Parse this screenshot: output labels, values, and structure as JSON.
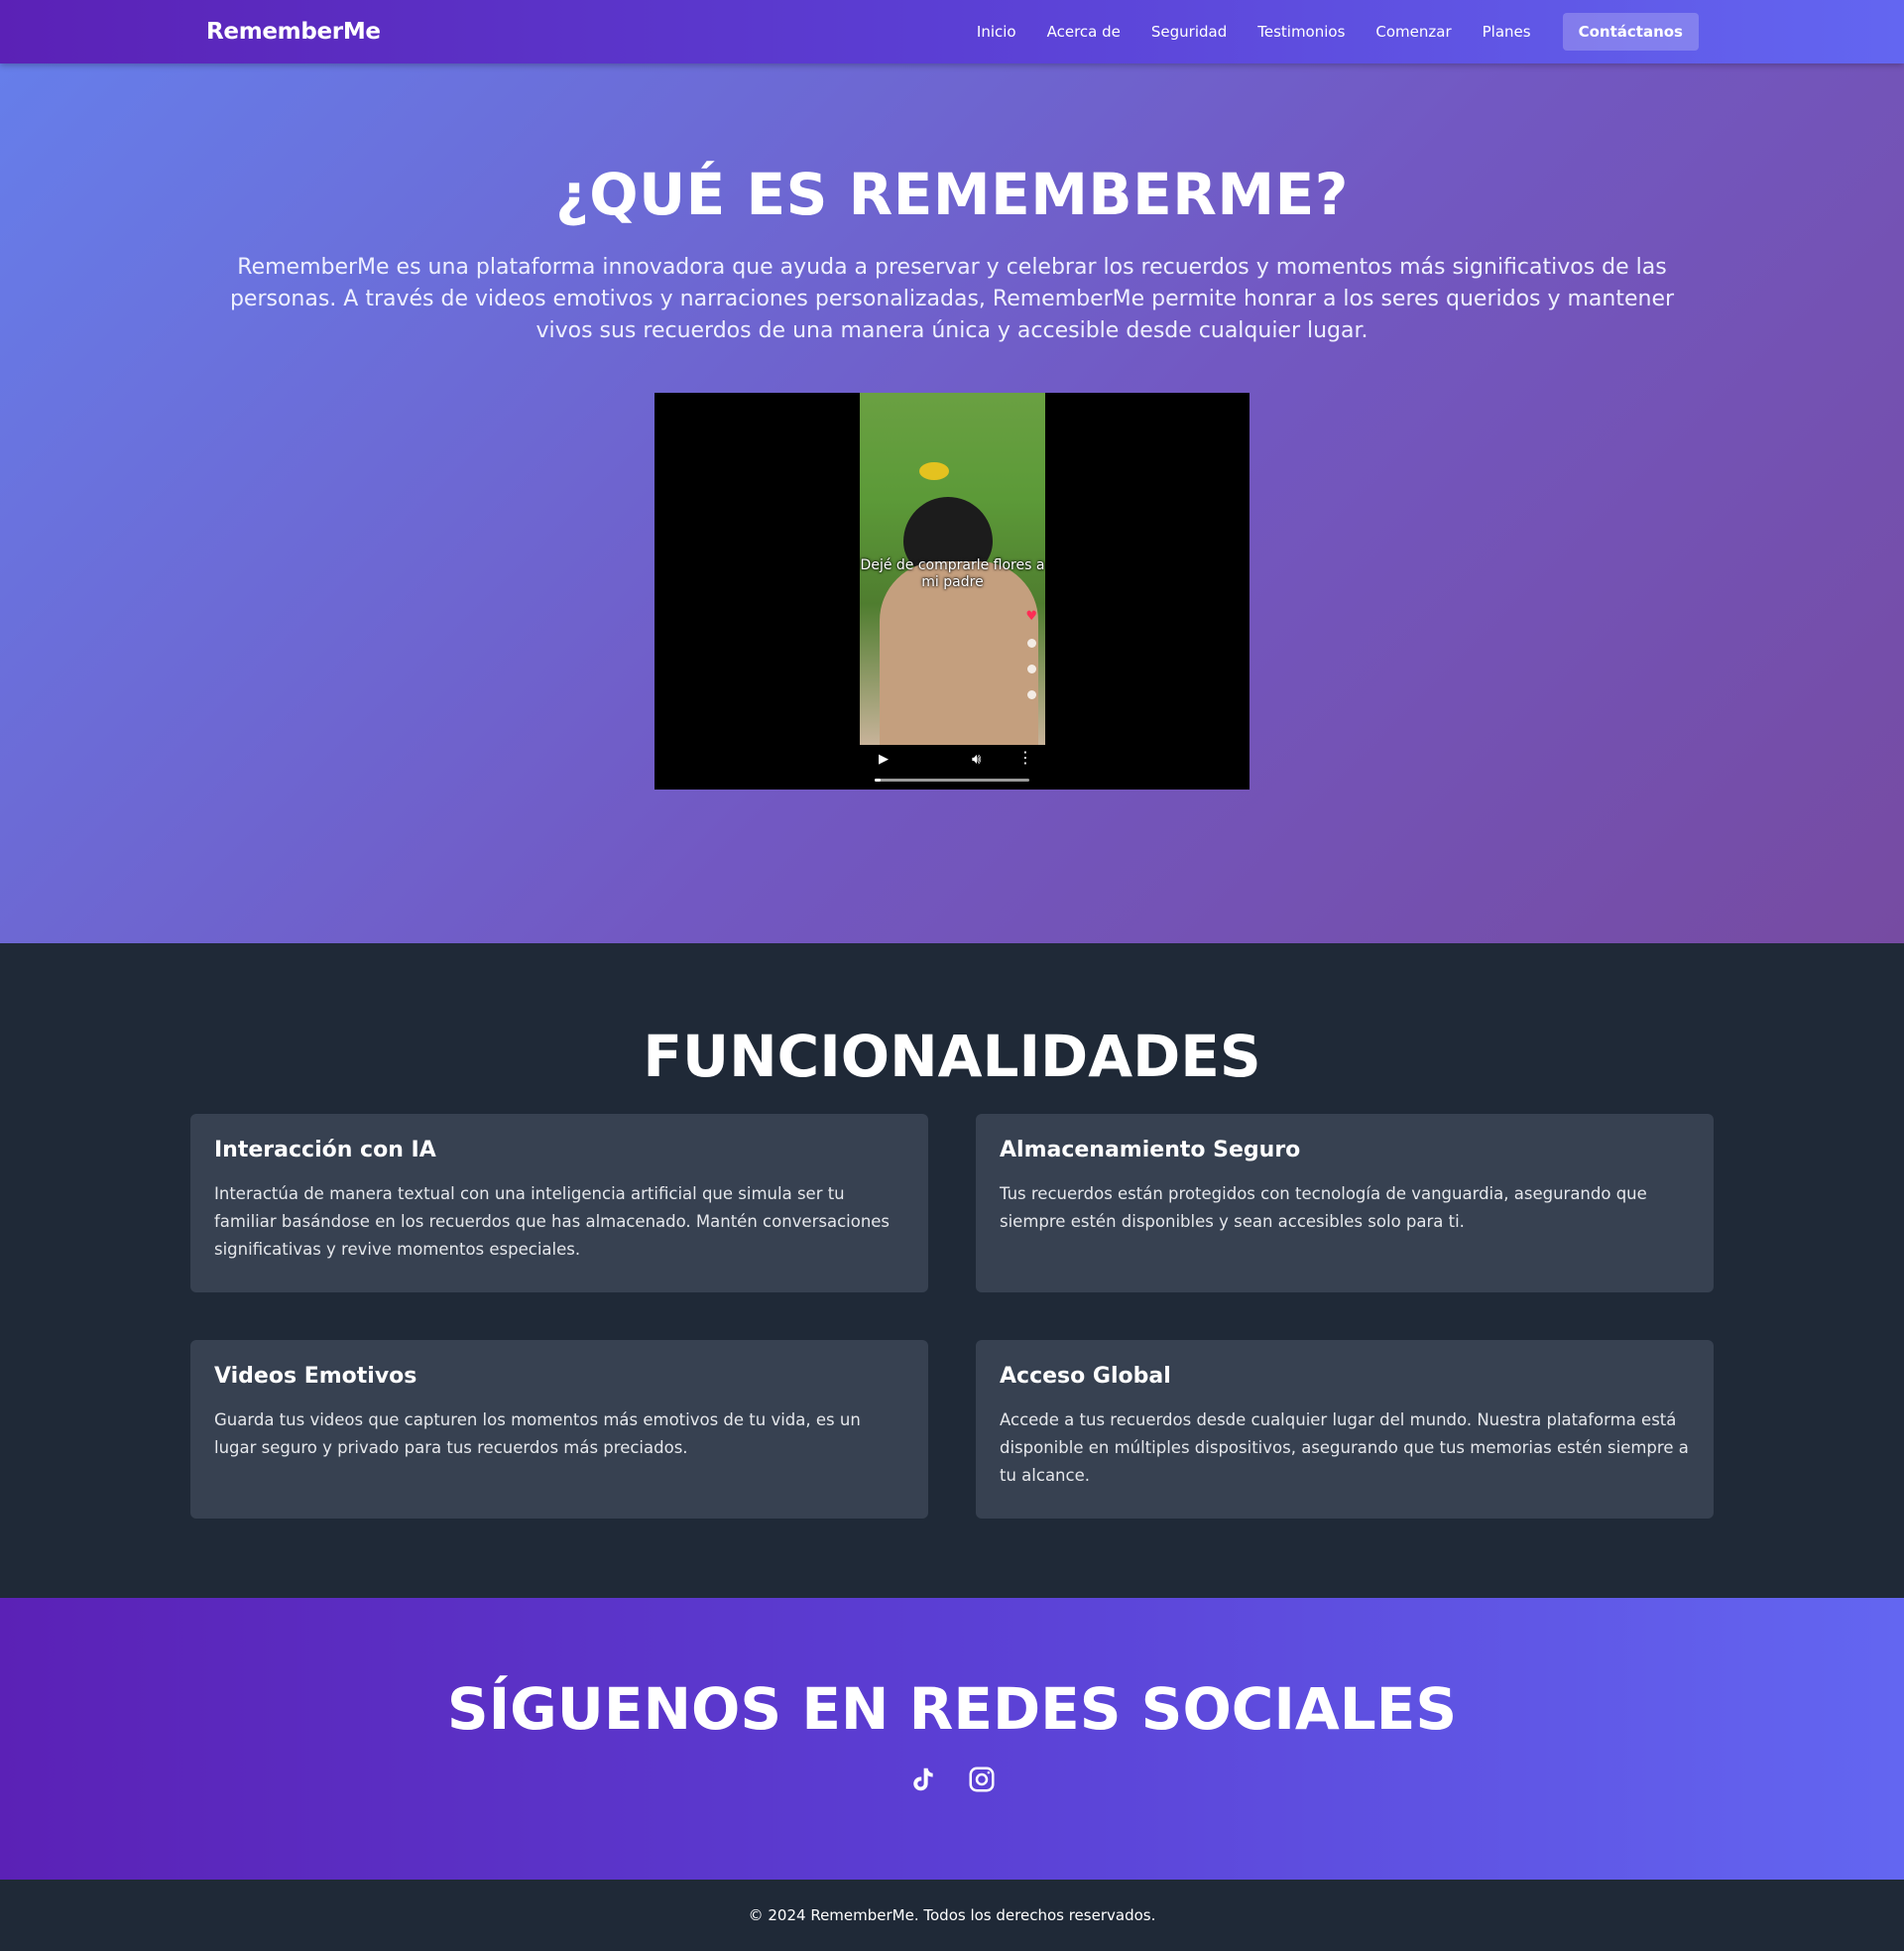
{
  "nav": {
    "brand": "RememberMe",
    "links": [
      "Inicio",
      "Acerca de",
      "Seguridad",
      "Testimonios",
      "Comenzar",
      "Planes"
    ],
    "cta": "Contáctanos"
  },
  "hero": {
    "title": "¿QUÉ ES REMEMBERME?",
    "description": "RememberMe es una plataforma innovadora que ayuda a preservar y celebrar los recuerdos y momentos más significativos de las personas. A través de videos emotivos y narraciones personalizadas, RememberMe permite honrar a los seres queridos y mantener vivos sus recuerdos de una manera única y accesible desde cualquier lugar.",
    "video_caption": "Dejé de comprarle flores a mi padre",
    "video_progress": 0.04
  },
  "features": {
    "title": "FUNCIONALIDADES",
    "items": [
      {
        "title": "Interacción con IA",
        "text": "Interactúa de manera textual con una inteligencia artificial que simula ser tu familiar basándose en los recuerdos que has almacenado. Mantén conversaciones significativas y revive momentos especiales."
      },
      {
        "title": "Almacenamiento Seguro",
        "text": "Tus recuerdos están protegidos con tecnología de vanguardia, asegurando que siempre estén disponibles y sean accesibles solo para ti."
      },
      {
        "title": "Videos Emotivos",
        "text": "Guarda tus videos que capturen los momentos más emotivos de tu vida, es un lugar seguro y privado para tus recuerdos más preciados."
      },
      {
        "title": "Acceso Global",
        "text": "Accede a tus recuerdos desde cualquier lugar del mundo. Nuestra plataforma está disponible en múltiples dispositivos, asegurando que tus memorias estén siempre a tu alcance."
      }
    ]
  },
  "social": {
    "title": "SÍGUENOS EN REDES SOCIALES",
    "icons": [
      "tiktok-icon",
      "instagram-icon"
    ]
  },
  "footer": {
    "text": "© 2024 RememberMe. Todos los derechos reservados."
  }
}
